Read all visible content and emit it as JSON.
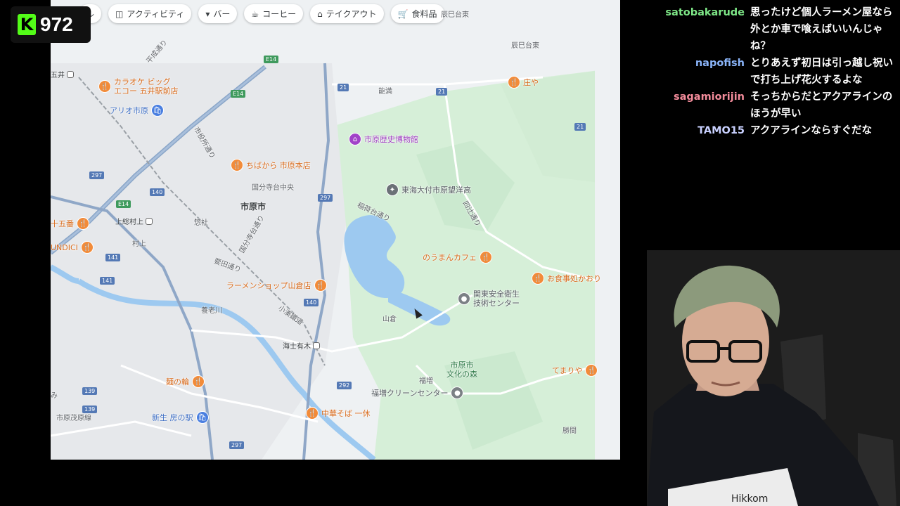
{
  "viewer_badge": {
    "logo": "K",
    "count": "972"
  },
  "map": {
    "chips": [
      {
        "icon": "attraction-icon",
        "label": "ル"
      },
      {
        "icon": "camera-icon",
        "label": "アクティビティ"
      },
      {
        "icon": "cocktail-icon",
        "label": "バー"
      },
      {
        "icon": "coffee-icon",
        "label": "コーヒー"
      },
      {
        "icon": "takeout-icon",
        "label": "テイクアウト"
      },
      {
        "icon": "cart-icon",
        "label": "食料品"
      }
    ],
    "pois": {
      "karaoke": "カラオケ ビッグ\nエコー 五井駅前店",
      "ario": "アリオ市原",
      "chibakara": "ちばから 市原本店",
      "museum": "市原歴史博物館",
      "school": "東海大付市原望洋高",
      "jugoban": "十五番",
      "undici": "UNDICI",
      "noumancafe": "のうまんカフェ",
      "shokujidokoro": "お食事処かおり",
      "ramen_yamakura": "ラーメンショップ山倉店",
      "kantou": "関東安全衛生\n技術センター",
      "shoya": "庄や",
      "temariya": "てまりや",
      "menowa": "麺の輪",
      "shinsei": "新生 房の駅",
      "ikkyu": "中華そば 一休",
      "fukumasu_clean": "福増クリーンセンター",
      "bunka": "市原市\n文化の森"
    },
    "places": {
      "city": "市原市",
      "goi": "五井",
      "kamisou_muraue": "上総村上",
      "muraue": "村上",
      "kokubunji": "国分寺台中央",
      "kokubunji_temple": "国分寺台通り",
      "sanso": "惣社",
      "yamakura": "山倉",
      "amaariki": "海士有木",
      "fukumasu": "福増",
      "katsuma": "勝間",
      "noumi": "能満",
      "tatsumidai": "辰巳台東",
      "tatsumidai2": "辰巳台東",
      "yotsuji": "四辻通り",
      "heisei": "平成通り",
      "ichihara_dori": "市役所通り",
      "yoro_river": "養老川",
      "kominato": "小湊鐵道",
      "mihara": "市原茂原線",
      "mi": "み",
      "yousei": "要田通り",
      "ichiharadai": "稲荷台通り"
    },
    "shields": [
      "E14",
      "E14",
      "E14",
      "21",
      "21",
      "21",
      "297",
      "297",
      "297",
      "140",
      "140",
      "141",
      "141",
      "292",
      "139",
      "139"
    ]
  },
  "chat": [
    {
      "user": "",
      "color": "#9aa7ff",
      "text": ""
    },
    {
      "user": "satobakarude",
      "color": "#7ee787",
      "text": "思ったけど個人ラーメン屋なら外とか車で喰えばいいんじゃね？"
    },
    {
      "user": "napofish",
      "color": "#8ab4f8",
      "text": "とりあえず初日は引っ越し祝いで打ち上げ花火するよな"
    },
    {
      "user": "sagamiorijin",
      "color": "#f28b9a",
      "text": "そっちからだとアクアラインのほうが早い"
    },
    {
      "user": "TAMO15",
      "color": "#c9d1ff",
      "text": "アクアラインならすぐだな"
    }
  ],
  "webcam": {
    "shirt_text": "Hikkom"
  }
}
